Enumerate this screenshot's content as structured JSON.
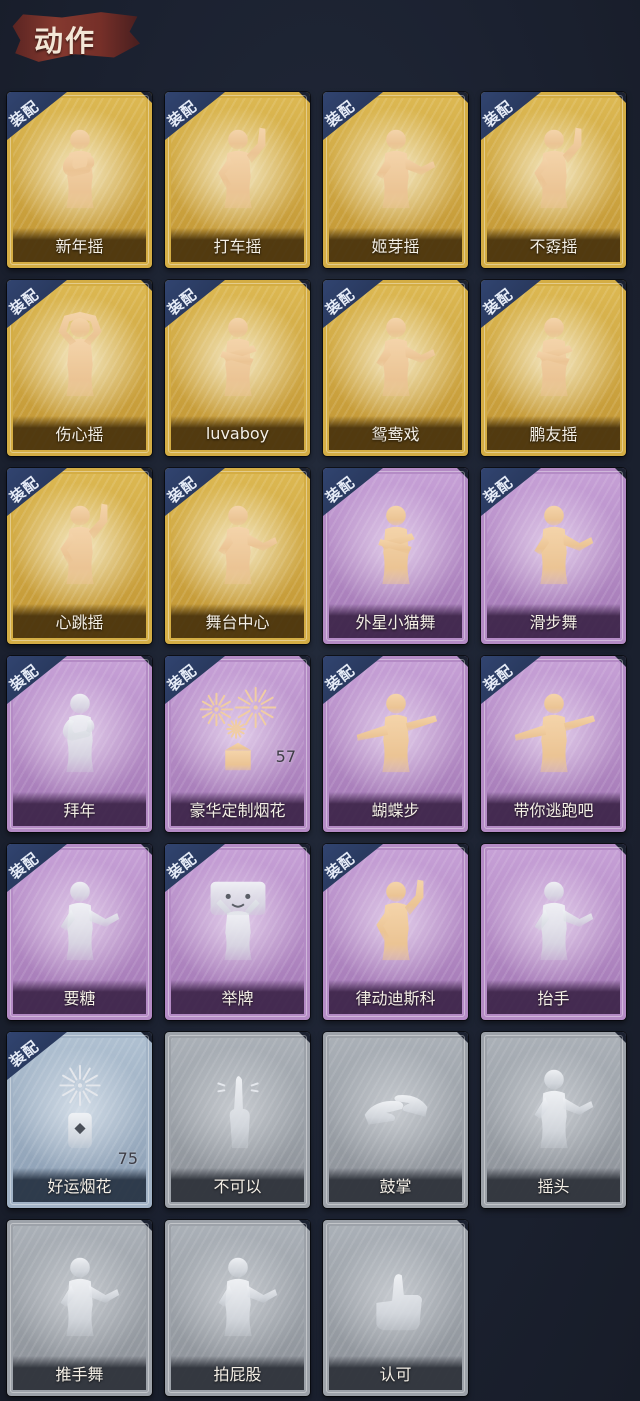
{
  "header": {
    "title": "动作"
  },
  "badge_label": "装配",
  "colors": {
    "background": "#1b2130",
    "badge": "#2a3a5e",
    "gold_frame": "#d4ad44",
    "purple_frame": "#b48bc5",
    "blue_frame": "#a2b3c6",
    "grey_frame": "#9da2a9",
    "figure_peach": "#f0cda3",
    "figure_silver": "#e4e7ec"
  },
  "actions": [
    {
      "name": "新年摇",
      "tier": "gold",
      "equipped": true,
      "icon": "clasp-hands-dance-icon",
      "figure": "peach"
    },
    {
      "name": "打车摇",
      "tier": "gold",
      "equipped": true,
      "icon": "arm-raise-dance-icon",
      "figure": "peach"
    },
    {
      "name": "姬芽摇",
      "tier": "gold",
      "equipped": true,
      "icon": "side-arm-dance-icon",
      "figure": "peach"
    },
    {
      "name": "不孬摇",
      "tier": "gold",
      "equipped": true,
      "icon": "arm-raise-dance-icon",
      "figure": "peach"
    },
    {
      "name": "伤心摇",
      "tier": "gold",
      "equipped": true,
      "icon": "heart-hands-dance-icon",
      "figure": "peach"
    },
    {
      "name": "luvaboy",
      "tier": "gold",
      "equipped": true,
      "icon": "crossed-arms-dance-icon",
      "figure": "peach"
    },
    {
      "name": "鸳鸯戏",
      "tier": "gold",
      "equipped": true,
      "icon": "side-arm-dance-icon",
      "figure": "peach"
    },
    {
      "name": "鹏友摇",
      "tier": "gold",
      "equipped": true,
      "icon": "crossed-arms-dance-icon",
      "figure": "peach"
    },
    {
      "name": "心跳摇",
      "tier": "gold",
      "equipped": true,
      "icon": "arm-raise-dance-icon",
      "figure": "peach"
    },
    {
      "name": "舞台中心",
      "tier": "gold",
      "equipped": true,
      "icon": "side-arm-dance-icon",
      "figure": "peach"
    },
    {
      "name": "外星小猫舞",
      "tier": "purple",
      "equipped": true,
      "icon": "crossed-arms-dance-icon",
      "figure": "peach"
    },
    {
      "name": "滑步舞",
      "tier": "purple",
      "equipped": true,
      "icon": "side-arm-dance-icon",
      "figure": "peach"
    },
    {
      "name": "拜年",
      "tier": "purple",
      "equipped": true,
      "icon": "clasp-hands-dance-icon",
      "figure": "silver"
    },
    {
      "name": "豪华定制烟花",
      "tier": "purple",
      "equipped": true,
      "icon": "fireworks-box-icon",
      "figure": "peach",
      "count": "57"
    },
    {
      "name": "蝴蝶步",
      "tier": "purple",
      "equipped": true,
      "icon": "pointing-dance-icon",
      "figure": "peach"
    },
    {
      "name": "带你逃跑吧",
      "tier": "purple",
      "equipped": true,
      "icon": "pointing-dance-icon",
      "figure": "peach"
    },
    {
      "name": "要糖",
      "tier": "purple",
      "equipped": true,
      "icon": "side-arm-dance-icon",
      "figure": "silver"
    },
    {
      "name": "举牌",
      "tier": "purple",
      "equipped": true,
      "icon": "hold-sign-icon",
      "figure": "silver"
    },
    {
      "name": "律动迪斯科",
      "tier": "purple",
      "equipped": true,
      "icon": "arm-raise-dance-icon",
      "figure": "peach"
    },
    {
      "name": "抬手",
      "tier": "purple",
      "equipped": false,
      "icon": "side-arm-dance-icon",
      "figure": "silver"
    },
    {
      "name": "好运烟花",
      "tier": "blue",
      "equipped": true,
      "icon": "firecracker-tube-icon",
      "figure": "silver",
      "count": "75"
    },
    {
      "name": "不可以",
      "tier": "grey",
      "equipped": false,
      "icon": "finger-wag-icon",
      "figure": "silver"
    },
    {
      "name": "鼓掌",
      "tier": "grey",
      "equipped": false,
      "icon": "clapping-hands-icon",
      "figure": "silver"
    },
    {
      "name": "摇头",
      "tier": "grey",
      "equipped": false,
      "icon": "side-arm-dance-icon",
      "figure": "silver"
    },
    {
      "name": "推手舞",
      "tier": "grey",
      "equipped": false,
      "icon": "side-arm-dance-icon",
      "figure": "silver"
    },
    {
      "name": "拍屁股",
      "tier": "grey",
      "equipped": false,
      "icon": "side-arm-dance-icon",
      "figure": "silver"
    },
    {
      "name": "认可",
      "tier": "grey",
      "equipped": false,
      "icon": "thumbs-up-icon",
      "figure": "silver"
    }
  ]
}
